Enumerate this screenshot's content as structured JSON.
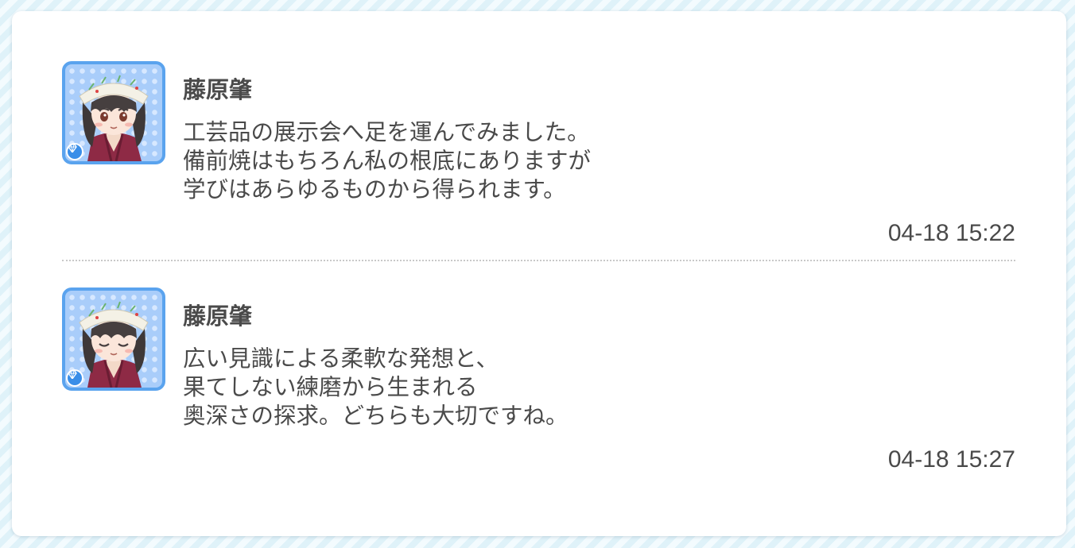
{
  "posts": [
    {
      "author": "藤原肇",
      "lines": [
        "工芸品の展示会へ足を運んでみました。",
        "備前焼はもちろん私の根底にありますが",
        "学びはあらゆるものから得られます。"
      ],
      "timestamp": "04-18 15:22",
      "avatar_expression": "eyes-open"
    },
    {
      "author": "藤原肇",
      "lines": [
        "広い見識による柔軟な発想と、",
        "果てしない練磨から生まれる",
        "奥深さの探求。どちらも大切ですね。"
      ],
      "timestamp": "04-18 15:27",
      "avatar_expression": "eyes-closed"
    }
  ],
  "icons": {
    "avatar_badge": "diamond-gem-icon"
  },
  "colors": {
    "avatar_border": "#5aa3ee",
    "badge": "#3a8ee8",
    "text": "#4a4a4a",
    "card": "#ffffff"
  }
}
